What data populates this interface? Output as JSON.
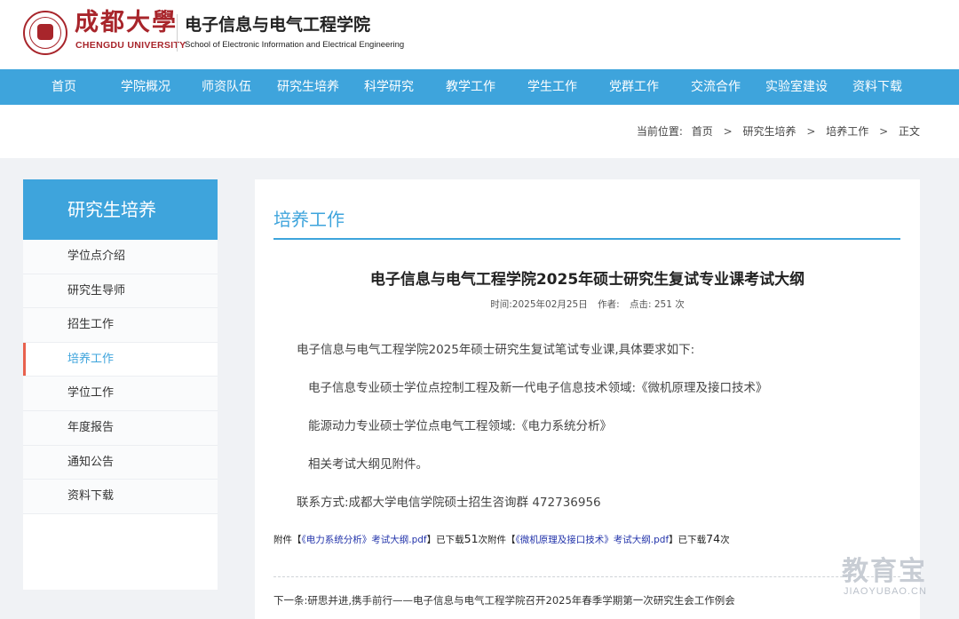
{
  "header": {
    "univ_cn": "成都大學",
    "univ_en": "CHENGDU UNIVERSITY",
    "school_cn": "电子信息与电气工程学院",
    "school_en": "School of Electronic Information and Electrical Engineering"
  },
  "nav": {
    "items": [
      "首页",
      "学院概况",
      "师资队伍",
      "研究生培养",
      "科学研究",
      "教学工作",
      "学生工作",
      "党群工作",
      "交流合作",
      "实验室建设",
      "资料下载"
    ]
  },
  "breadcrumb": {
    "label": "当前位置:",
    "items": [
      "首页",
      "研究生培养",
      "培养工作",
      "正文"
    ],
    "sep": ">"
  },
  "sidebar": {
    "title": "研究生培养",
    "items": [
      "学位点介绍",
      "研究生导师",
      "招生工作",
      "培养工作",
      "学位工作",
      "年度报告",
      "通知公告",
      "资料下载"
    ],
    "active_index": 3
  },
  "article": {
    "section_title": "培养工作",
    "title": "电子信息与电气工程学院2025年硕士研究生复试专业课考试大纲",
    "time": "时间:2025年02月25日",
    "author": "作者:",
    "clicks": "点击: 251 次",
    "paragraphs": [
      "电子信息与电气工程学院2025年硕士研究生复试笔试专业课,具体要求如下:",
      "电子信息专业硕士学位点控制工程及新一代电子信息技术领域:《微机原理及接口技术》",
      "能源动力专业硕士学位点电气工程领域:《电力系统分析》",
      "相关考试大纲见附件。",
      "联系方式:成都大学电信学院硕士招生咨询群 472736956"
    ],
    "attachments": {
      "prefix1": "附件【",
      "file1": "《电力系统分析》考试大纲.pdf",
      "mid1": "】已下载",
      "count1": "51",
      "prefix2": "次附件【",
      "file2": "《微机原理及接口技术》考试大纲.pdf",
      "mid2": "】已下载",
      "count2": "74",
      "suffix": "次"
    },
    "next": "下一条:研思并进,携手前行——电子信息与电气工程学院召开2025年春季学期第一次研究生会工作例会"
  },
  "watermark": {
    "cn": "教育宝",
    "en": "JIAOYUBAO.CN"
  },
  "colors": {
    "brand_red": "#a8252b",
    "nav_blue": "#3ea4dc",
    "active_marker": "#e8614d",
    "link_blue": "#2233aa"
  }
}
